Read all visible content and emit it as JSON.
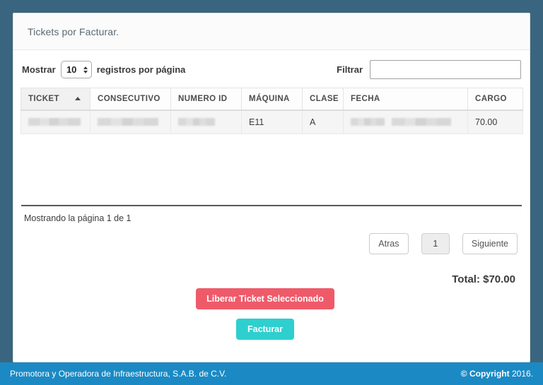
{
  "panel": {
    "title": "Tickets por Facturar."
  },
  "controls": {
    "length_label_pre": "Mostrar",
    "length_value": "10",
    "length_label_post": "registros por página",
    "filter_label": "Filtrar",
    "filter_value": "",
    "filter_placeholder": ""
  },
  "table": {
    "columns": [
      {
        "label": "TICKET",
        "sorted": "asc"
      },
      {
        "label": "CONSECUTIVO",
        "sorted": ""
      },
      {
        "label": "NUMERO ID",
        "sorted": ""
      },
      {
        "label": "MÁQUINA",
        "sorted": ""
      },
      {
        "label": "CLASE",
        "sorted": ""
      },
      {
        "label": "FECHA",
        "sorted": ""
      },
      {
        "label": "CARGO",
        "sorted": ""
      }
    ],
    "rows": [
      {
        "ticket": "",
        "consecutivo": "",
        "numero_id": "",
        "maquina": "E11",
        "clase": "A",
        "fecha": "",
        "cargo": "70.00",
        "selected": true
      }
    ]
  },
  "pager": {
    "info": "Mostrando la página 1 de 1",
    "prev_label": "Atras",
    "current_page": "1",
    "next_label": "Siguiente"
  },
  "summary": {
    "total": "Total: $70.00"
  },
  "actions": {
    "liberar_label": "Liberar Ticket Seleccionado",
    "facturar_label": "Facturar"
  },
  "footer": {
    "left": "Promotora y Operadora de Infraestructura, S.A.B. de C.V.",
    "copyright_strong": "© Copyright",
    "copyright_year": "2016."
  },
  "colors": {
    "page_background": "#3a6580",
    "footer_background": "#1b8ac4",
    "danger_button": "#ef5a69",
    "primary_button": "#2ecfcf",
    "panel_background": "#ffffff"
  }
}
